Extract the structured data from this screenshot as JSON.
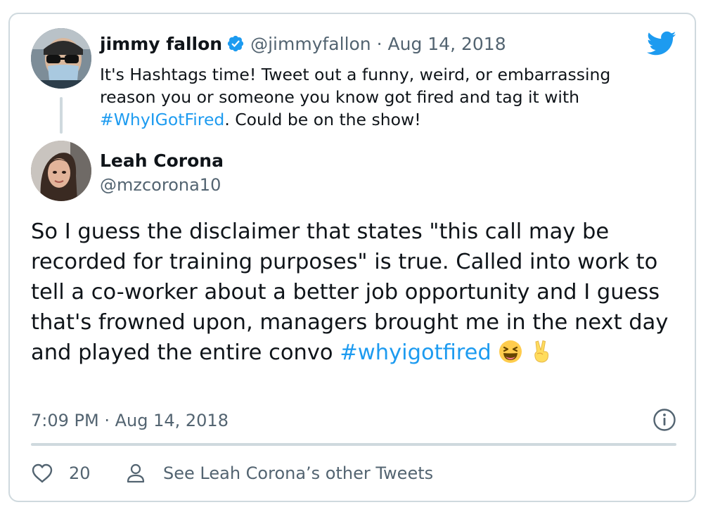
{
  "quoted_tweet": {
    "name": "jimmy fallon",
    "handle": "@jimmyfallon",
    "separator": "·",
    "date": "Aug 14, 2018",
    "text_before": "It's Hashtags time! Tweet out a funny, weird, or embarrassing reason you or someone you know got fired and tag it with ",
    "hashtag": "#WhyIGotFired",
    "text_after": ". Could be on the show!",
    "verified": true
  },
  "tweet": {
    "name": "Leah Corona",
    "handle": "@mzcorona10",
    "text": "So I guess the disclaimer that states \"this call may be recorded for training purposes\" is true. Called into work to tell a co-worker about a better job opportunity and I guess that's frowned upon, managers brought me in the next day and played the entire convo ",
    "hashtag": "#whyigotfired",
    "emojis": [
      "laughing-face-emoji",
      "victory-hand-emoji"
    ],
    "timestamp": "7:09 PM · Aug 14, 2018"
  },
  "footer": {
    "like_count": "20",
    "see_more": "See Leah Corona’s other Tweets"
  },
  "colors": {
    "link": "#1d9bf0",
    "muted": "#536471",
    "border": "#cfd9de",
    "text": "#0f1419"
  },
  "icons": [
    "twitter-bird-icon",
    "verified-badge-icon",
    "info-icon",
    "heart-icon",
    "person-icon"
  ]
}
